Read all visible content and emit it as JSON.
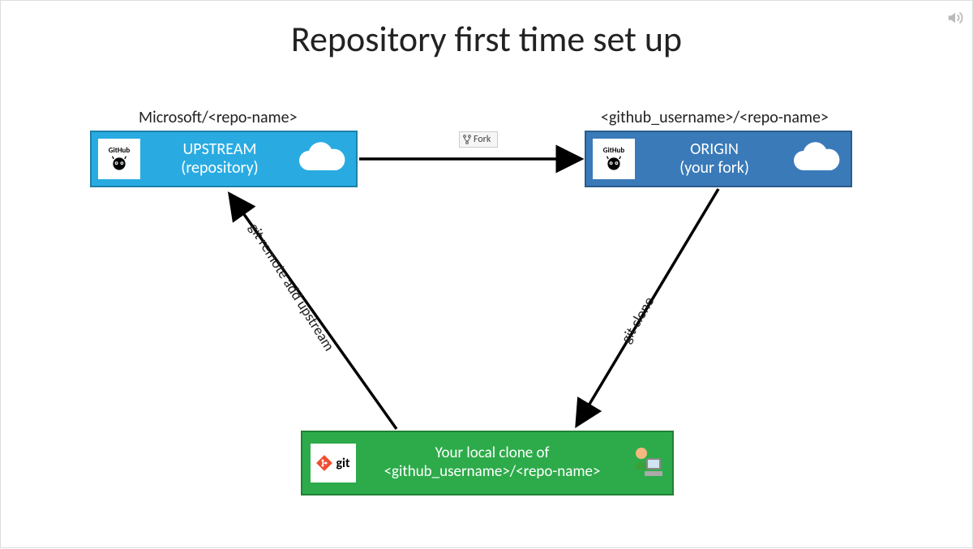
{
  "title": "Repository first time set up",
  "upstream": {
    "path_label": "Microsoft/<repo-name>",
    "badge": "GitHub",
    "line1": "UPSTREAM",
    "line2": "(repository)"
  },
  "origin": {
    "path_label": "<github_username>/<repo-name>",
    "badge": "GitHub",
    "line1": "ORIGIN",
    "line2": "(your fork)"
  },
  "local": {
    "badge": "git",
    "line1": "Your local clone of",
    "line2": "<github_username>/<repo-name>"
  },
  "arrows": {
    "fork": "Fork",
    "clone": "git clone",
    "remote_add": "git remote add upstream"
  },
  "colors": {
    "upstream": "#29abe2",
    "origin": "#3a7ab8",
    "local": "#2dab4a"
  }
}
